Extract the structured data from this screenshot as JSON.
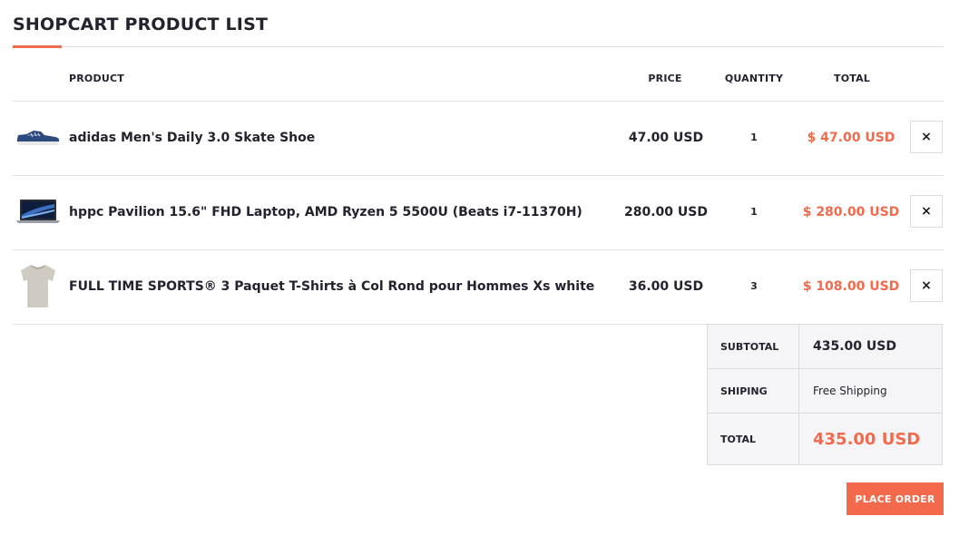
{
  "page": {
    "title": "SHOPCART PRODUCT LIST"
  },
  "colors": {
    "accent": "#f26a4b",
    "text": "#23232f",
    "border": "#dcdcdc",
    "summary_bg": "#f5f5f7"
  },
  "table": {
    "headers": {
      "product": "PRODUCT",
      "price": "PRICE",
      "quantity": "QUANTITY",
      "total": "TOTAL"
    },
    "rows": [
      {
        "thumb_icon": "sneaker-icon",
        "name": "adidas Men's Daily 3.0 Skate Shoe",
        "price": "47.00 USD",
        "quantity": "1",
        "total": "$ 47.00 USD",
        "remove_label": "×"
      },
      {
        "thumb_icon": "laptop-icon",
        "name": "hppc Pavilion 15.6\" FHD Laptop, AMD Ryzen 5 5500U (Beats i7-11370H)",
        "price": "280.00 USD",
        "quantity": "1",
        "total": "$ 280.00 USD",
        "remove_label": "×"
      },
      {
        "thumb_icon": "tshirt-icon",
        "name": "FULL TIME SPORTS® 3 Paquet T-Shirts à Col Rond pour Hommes Xs white",
        "price": "36.00 USD",
        "quantity": "3",
        "total": "$ 108.00 USD",
        "remove_label": "×"
      }
    ]
  },
  "summary": {
    "subtotal_label": "SUBTOTAL",
    "subtotal_value": "435.00 USD",
    "shipping_label": "SHIPING",
    "shipping_value": "Free Shipping",
    "total_label": "TOTAL",
    "total_value": "435.00 USD"
  },
  "actions": {
    "place_order": "PLACE ORDER"
  }
}
